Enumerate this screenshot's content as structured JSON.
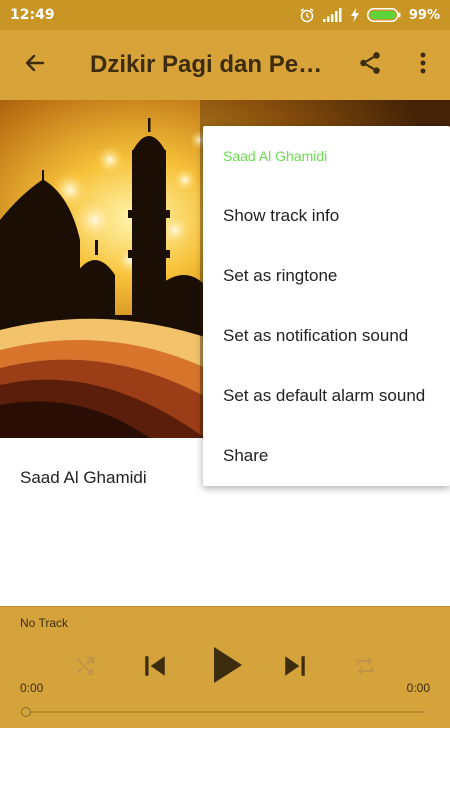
{
  "status_bar": {
    "time": "12:49",
    "battery": "99%"
  },
  "app_bar": {
    "title": "Dzikir Pagi dan Petang"
  },
  "track": {
    "title": "Saad Al Ghamidi"
  },
  "player": {
    "now_playing": "No Track",
    "elapsed": "0:00",
    "duration": "0:00",
    "progress": 0
  },
  "menu": {
    "header": "Saad Al Ghamidi",
    "items": [
      {
        "label": "Show track info"
      },
      {
        "label": "Set as ringtone"
      },
      {
        "label": "Set as notification sound"
      },
      {
        "label": "Set as default alarm sound"
      },
      {
        "label": "Share"
      }
    ]
  },
  "colors": {
    "status_bar": "#c99524",
    "app_bar": "#d8a43a",
    "player": "#d4a33c",
    "menu_header": "#6bdc4e"
  },
  "icons": [
    "alarm-icon",
    "signal-icon",
    "charging-icon",
    "battery-icon",
    "back-arrow-icon",
    "share-icon",
    "more-vert-icon",
    "shuffle-icon",
    "skip-previous-icon",
    "play-icon",
    "skip-next-icon",
    "repeat-icon"
  ]
}
